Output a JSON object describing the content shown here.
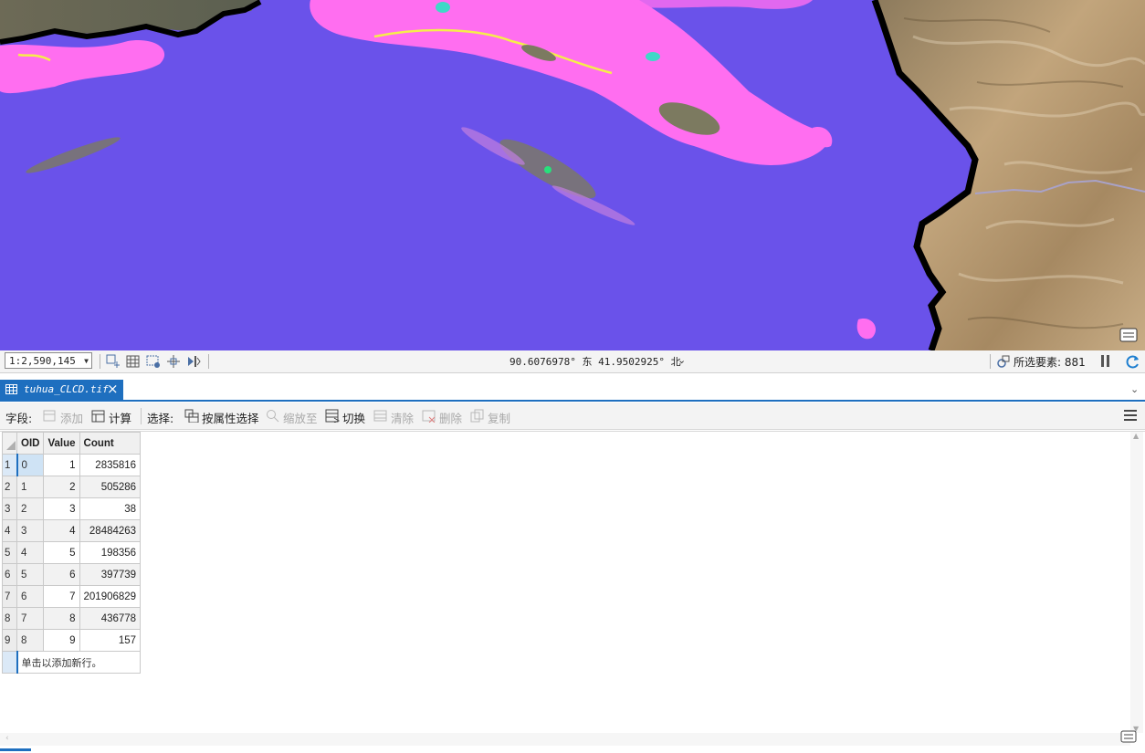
{
  "map": {
    "icon": "map-tips-icon"
  },
  "status_bar": {
    "scale": "1:2,590,145",
    "coordinates": "90.6076978° 东 41.9502925° 北",
    "selected_features": "所选要素: 881"
  },
  "tab": {
    "title": "tuhua_CLCD.tif"
  },
  "toolbar": {
    "field_label": "字段:",
    "add_label": "添加",
    "calculate_label": "计算",
    "selection_label": "选择:",
    "select_by_attributes_label": "按属性选择",
    "zoom_to_label": "缩放至",
    "switch_label": "切换",
    "clear_label": "清除",
    "delete_label": "删除",
    "copy_label": "复制"
  },
  "table": {
    "columns": [
      "OID",
      "Value",
      "Count"
    ],
    "rows": [
      {
        "n": "1",
        "oid": "0",
        "value": "1",
        "count": "2835816"
      },
      {
        "n": "2",
        "oid": "1",
        "value": "2",
        "count": "505286"
      },
      {
        "n": "3",
        "oid": "2",
        "value": "3",
        "count": "38"
      },
      {
        "n": "4",
        "oid": "3",
        "value": "4",
        "count": "28484263"
      },
      {
        "n": "5",
        "oid": "4",
        "value": "5",
        "count": "198356"
      },
      {
        "n": "6",
        "oid": "5",
        "value": "6",
        "count": "397739"
      },
      {
        "n": "7",
        "oid": "6",
        "value": "7",
        "count": "201906829"
      },
      {
        "n": "8",
        "oid": "7",
        "value": "8",
        "count": "436778"
      },
      {
        "n": "9",
        "oid": "8",
        "value": "9",
        "count": "157"
      }
    ],
    "new_row_hint": "单击以添加新行。"
  },
  "colors": {
    "map_background": "#6a52ea",
    "landcover_pink": "#ff6ef0",
    "terrain": "#b89a72",
    "boundary": "#000000",
    "accent": "#1e6fbf"
  }
}
